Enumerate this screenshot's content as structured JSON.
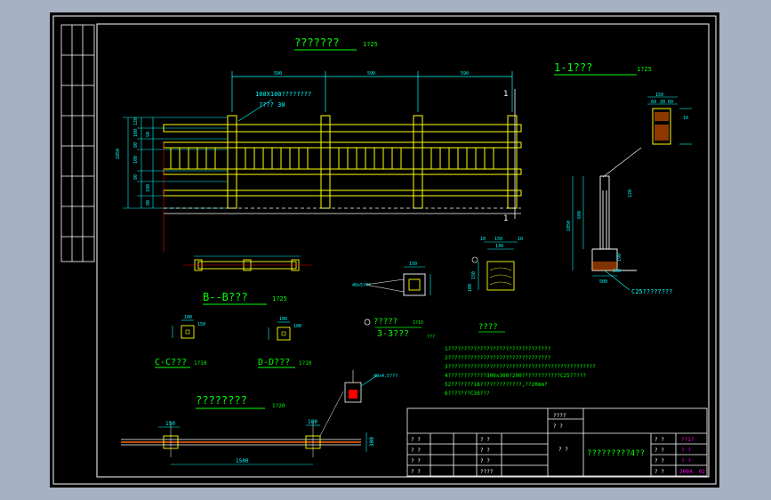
{
  "colors": {
    "background": "#000000",
    "viewport": "#a6b1c4",
    "border": "#ffffff",
    "title_text": "#00ff00",
    "dimension": "#00ffff",
    "rail": "#ffff00",
    "hatch": "#ff6600",
    "title_block_red": "#ff0000",
    "title_block_magenta": "#ff00ff"
  },
  "titles": {
    "elevation": "???????",
    "elevation_scale": "1?25",
    "section_1_1": "1-1???",
    "section_1_1_scale": "1?25",
    "section_b_b": "B--B???",
    "section_b_b_scale": "1?25",
    "section_c_c": "C-C???",
    "section_c_c_scale": "1?10",
    "section_d_d": "D-D???",
    "section_d_d_scale": "1?10",
    "section_3_3": "3-3???",
    "section_3_3_scale": "???",
    "detail_1": "?????",
    "detail_1_scale": "1?10",
    "plan": "????????",
    "plan_scale": "1?20",
    "notes_heading": "????"
  },
  "annotations": {
    "post_size": "100X100????????",
    "post_size_b": "???? 30",
    "c25": "C25????????",
    "d_callout": "40x5???",
    "e_callout": "40x4.5???",
    "section_mark": "1"
  },
  "dimensions": {
    "span_1": "590",
    "span_2": "590",
    "span_3": "590",
    "top_150": "150",
    "top_10a": "10",
    "top_10b": "10",
    "top_130": "130",
    "side_150": "150",
    "side_100": "100",
    "side_190": "190",
    "side_120": "120",
    "plan_150": "150",
    "plan_100": "100",
    "plan_1500": "1500",
    "plan_300": "300",
    "cap_150": "150",
    "cap_60a": "60",
    "cap_30": "30",
    "cap_60b": "60",
    "cap_10": "10",
    "sec_1050": "1050",
    "sec_600": "600",
    "sec_200": "200",
    "sec_500": "500",
    "dd_100a": "100",
    "dd_100b": "100",
    "cc_100": "100",
    "cc_150": "150",
    "elev_v1": "120",
    "elev_v2": "100",
    "elev_v3": "80",
    "elev_v4": "100",
    "elev_v5": "80",
    "elev_v6": "100",
    "elev_v7": "80",
    "elev_total": "1050",
    "elev_gap": "50"
  },
  "notes": [
    "1????????????????????????????????",
    "2????????????????????????????????",
    "3??????????????????????????????????????????????",
    "4????????????300x300?200????????????C25?????",
    "52???????18?????????????,??20mm?",
    "6???????C30???"
  ],
  "title_block": {
    "header_1": "????",
    "header_2": "? ?",
    "drawing_name": "?????????4??",
    "rows_left": [
      "? ?",
      "? ?",
      "? ?",
      "? ?"
    ],
    "rows_mid": [
      "? ?",
      "? ?",
      "? ?",
      "????"
    ],
    "center_label": "? ?",
    "right_labels": [
      "? ?",
      "? ?",
      "? ?",
      "? ?"
    ],
    "right_values": [
      "??1?",
      "? ?",
      "? ?",
      "2004. 02"
    ]
  }
}
